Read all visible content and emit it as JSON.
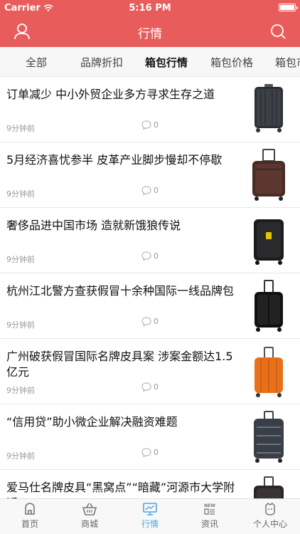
{
  "status": {
    "carrier": "Carrier",
    "time": "5:16 PM"
  },
  "navbar": {
    "title": "行情",
    "left_icon": "user-icon",
    "right_icon": "search-icon",
    "bg": "#e85c5c"
  },
  "tabs": [
    {
      "label": "全部"
    },
    {
      "label": "品牌折扣"
    },
    {
      "label": "箱包行情",
      "active": true
    },
    {
      "label": "箱包价格"
    },
    {
      "label": "箱包市"
    }
  ],
  "articles": [
    {
      "title": "订单减少 中小外贸企业多方寻求生存之道",
      "time": "9分钟前",
      "comments": "0",
      "thumb": "dark-carbon-suitcase"
    },
    {
      "title": "5月经济喜忧参半 皮革产业脚步慢却不停歇",
      "time": "9分钟前",
      "comments": "0",
      "thumb": "brown-leather-trolley"
    },
    {
      "title": "奢侈品进中国市场 造就新饿狼传说",
      "time": "9分钟前",
      "comments": "0",
      "thumb": "black-ferrari-suitcase"
    },
    {
      "title": "杭州江北警方查获假冒十余种国际一线品牌包",
      "time": "9分钟前",
      "comments": "0",
      "thumb": "black-hardshell-suitcase"
    },
    {
      "title": "广州破获假冒国际名牌皮具案 涉案金额达1.5亿元",
      "time": "9分钟前",
      "comments": "0",
      "thumb": "orange-suitcase"
    },
    {
      "title": "“信用贷”助小微企业解决融资难题",
      "time": "9分钟前",
      "comments": "0",
      "thumb": "grey-striped-suitcase"
    },
    {
      "title": "爱马仕名牌皮具“黑窝点”“暗藏”河源市大学附近",
      "time": "",
      "comments": "",
      "thumb": "dark-suitcase"
    }
  ],
  "tabbar": [
    {
      "label": "首页",
      "icon": "home-icon"
    },
    {
      "label": "商城",
      "icon": "basket-icon"
    },
    {
      "label": "行情",
      "icon": "monitor-icon",
      "active": true
    },
    {
      "label": "资讯",
      "icon": "news-icon",
      "badge": "NEW"
    },
    {
      "label": "个人中心",
      "icon": "profile-icon"
    }
  ]
}
